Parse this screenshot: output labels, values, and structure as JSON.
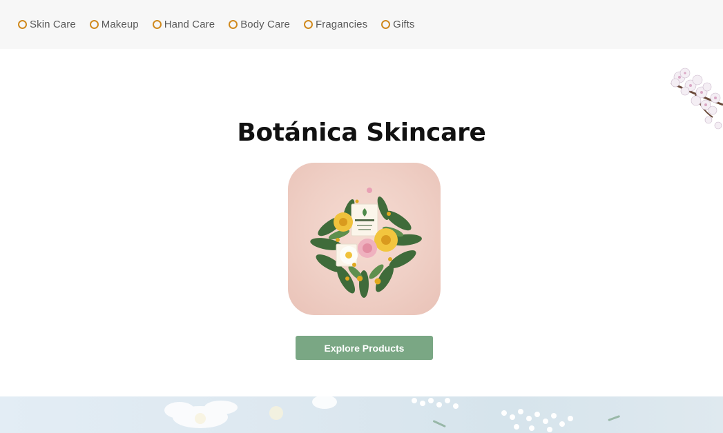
{
  "nav": {
    "items": [
      {
        "label": "Skin Care"
      },
      {
        "label": "Makeup"
      },
      {
        "label": "Hand Care"
      },
      {
        "label": "Body Care"
      },
      {
        "label": "Fragancies"
      },
      {
        "label": "Gifts"
      }
    ],
    "ring_color": "#d08a1f"
  },
  "hero": {
    "title": "Botánica Skincare",
    "image_icon": "botanical-arrangement-image",
    "button_label": "Explore Products",
    "button_color": "#7aa784"
  },
  "decor": {
    "corner_icon": "cherry-blossom-branch",
    "banner_icon": "white-flowers-banner"
  }
}
